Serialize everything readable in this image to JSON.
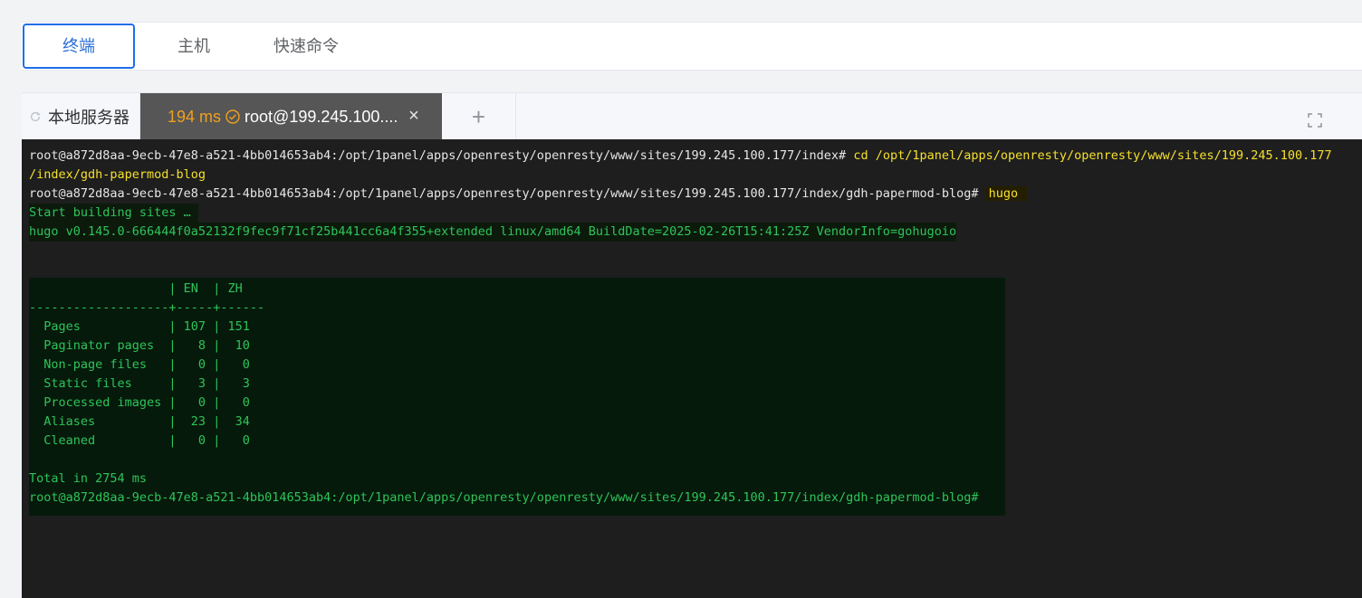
{
  "nav": {
    "tabs": [
      {
        "label": "终端"
      },
      {
        "label": "主机"
      },
      {
        "label": "快速命令"
      }
    ]
  },
  "tabs": {
    "local_label": "本地服务器",
    "active": {
      "latency": "194 ms",
      "title": "root@199.245.100...."
    },
    "close_glyph": "×",
    "add_glyph": "+"
  },
  "terminal": {
    "lines": [
      {
        "prompt": "root@a872d8aa-9ecb-47e8-a521-4bb014653ab4:/opt/1panel/apps/openresty/openresty/www/sites/199.245.100.177/index# ",
        "cmd": "cd /opt/1panel/apps/openresty/openresty/www/sites/199.245.100.177"
      },
      {
        "cmd": "/index/gdh-papermod-blog"
      },
      {
        "prompt": "root@a872d8aa-9ecb-47e8-a521-4bb014653ab4:/opt/1panel/apps/openresty/openresty/www/sites/199.245.100.177/index/gdh-papermod-blog# ",
        "cmd": "hugo"
      },
      {
        "text": "Start building sites … "
      },
      {
        "text": "hugo v0.145.0-666444f0a52132f9fec9f71cf25b441cc6a4f355+extended linux/amd64 BuildDate=2025-02-26T15:41:25Z VendorInfo=gohugoio"
      },
      {
        "text": "                   | EN  | ZH  "
      },
      {
        "text": "-------------------+-----+------"
      },
      {
        "text": "  Pages            | 107 | 151  "
      },
      {
        "text": "  Paginator pages  |   8 |  10  "
      },
      {
        "text": "  Non-page files   |   0 |   0  "
      },
      {
        "text": "  Static files     |   3 |   3  "
      },
      {
        "text": "  Processed images |   0 |   0  "
      },
      {
        "text": "  Aliases          |  23 |  34  "
      },
      {
        "text": "  Cleaned          |   0 |   0  "
      },
      {
        "text": "Total in 2754 ms"
      },
      {
        "text": "root@a872d8aa-9ecb-47e8-a521-4bb014653ab4:/opt/1panel/apps/openresty/openresty/www/sites/199.245.100.177/index/gdh-papermod-blog# "
      }
    ]
  },
  "colors": {
    "accent": "#1f6feb",
    "latency": "#f0a020",
    "terminal_bg": "#1e1e1e",
    "command": "#f5e02c",
    "output": "#2ec45a"
  }
}
